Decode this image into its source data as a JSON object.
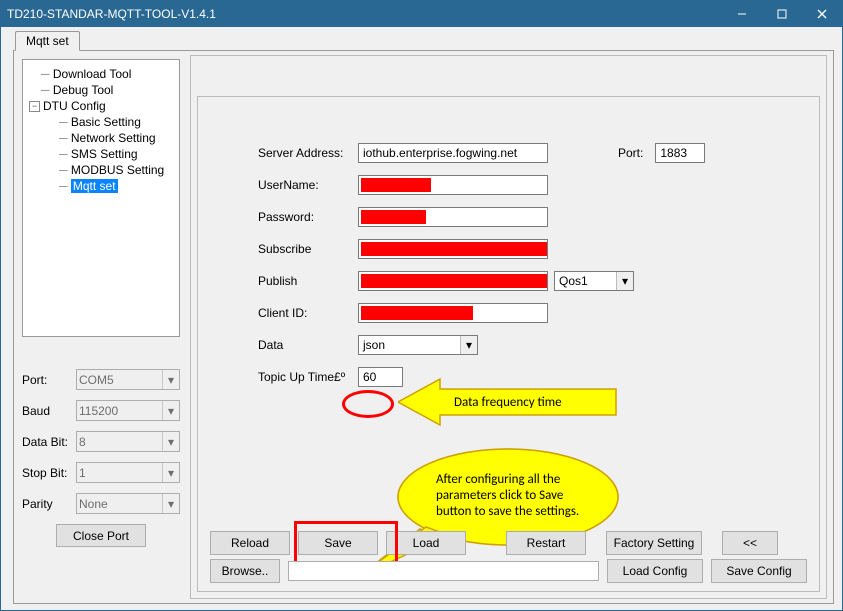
{
  "title": "TD210-STANDAR-MQTT-TOOL-V1.4.1",
  "tab": "Mqtt set",
  "tree": {
    "n1": "Download Tool",
    "n2": "Debug Tool",
    "n3": "DTU Config",
    "n31": "Basic Setting",
    "n32": "Network Setting",
    "n33": "SMS Setting",
    "n34": "MODBUS Setting",
    "n35": "Mqtt set"
  },
  "side": {
    "port_lbl": "Port:",
    "port_val": "COM5",
    "baud_lbl": "Baud",
    "baud_val": "115200",
    "databit_lbl": "Data Bit:",
    "databit_val": "8",
    "stopbit_lbl": "Stop Bit:",
    "stopbit_val": "1",
    "parity_lbl": "Parity",
    "parity_val": "None",
    "close_port": "Close Port"
  },
  "form": {
    "server_lbl": "Server Address:",
    "server_val": "iothub.enterprise.fogwing.net",
    "port_lbl": "Port:",
    "port_val": "1883",
    "user_lbl": "UserName:",
    "pass_lbl": "Password:",
    "sub_lbl": "Subscribe",
    "pub_lbl": "Publish",
    "qos_val": "Qos1",
    "client_lbl": "Client ID:",
    "data_lbl": "Data",
    "data_val": "json",
    "topic_lbl": "Topic Up Time£º",
    "topic_val": "60"
  },
  "buttons": {
    "reload": "Reload",
    "save": "Save",
    "load": "Load",
    "restart": "Restart",
    "factory": "Factory Setting",
    "back": "<<",
    "browse": "Browse..",
    "loadcfg": "Load Config",
    "savecfg": "Save Config"
  },
  "annot": {
    "arrow_text": "Data frequency time",
    "oval_l1": "After configuring all the",
    "oval_l2": "parameters click to Save",
    "oval_l3": "button to save the settings."
  }
}
